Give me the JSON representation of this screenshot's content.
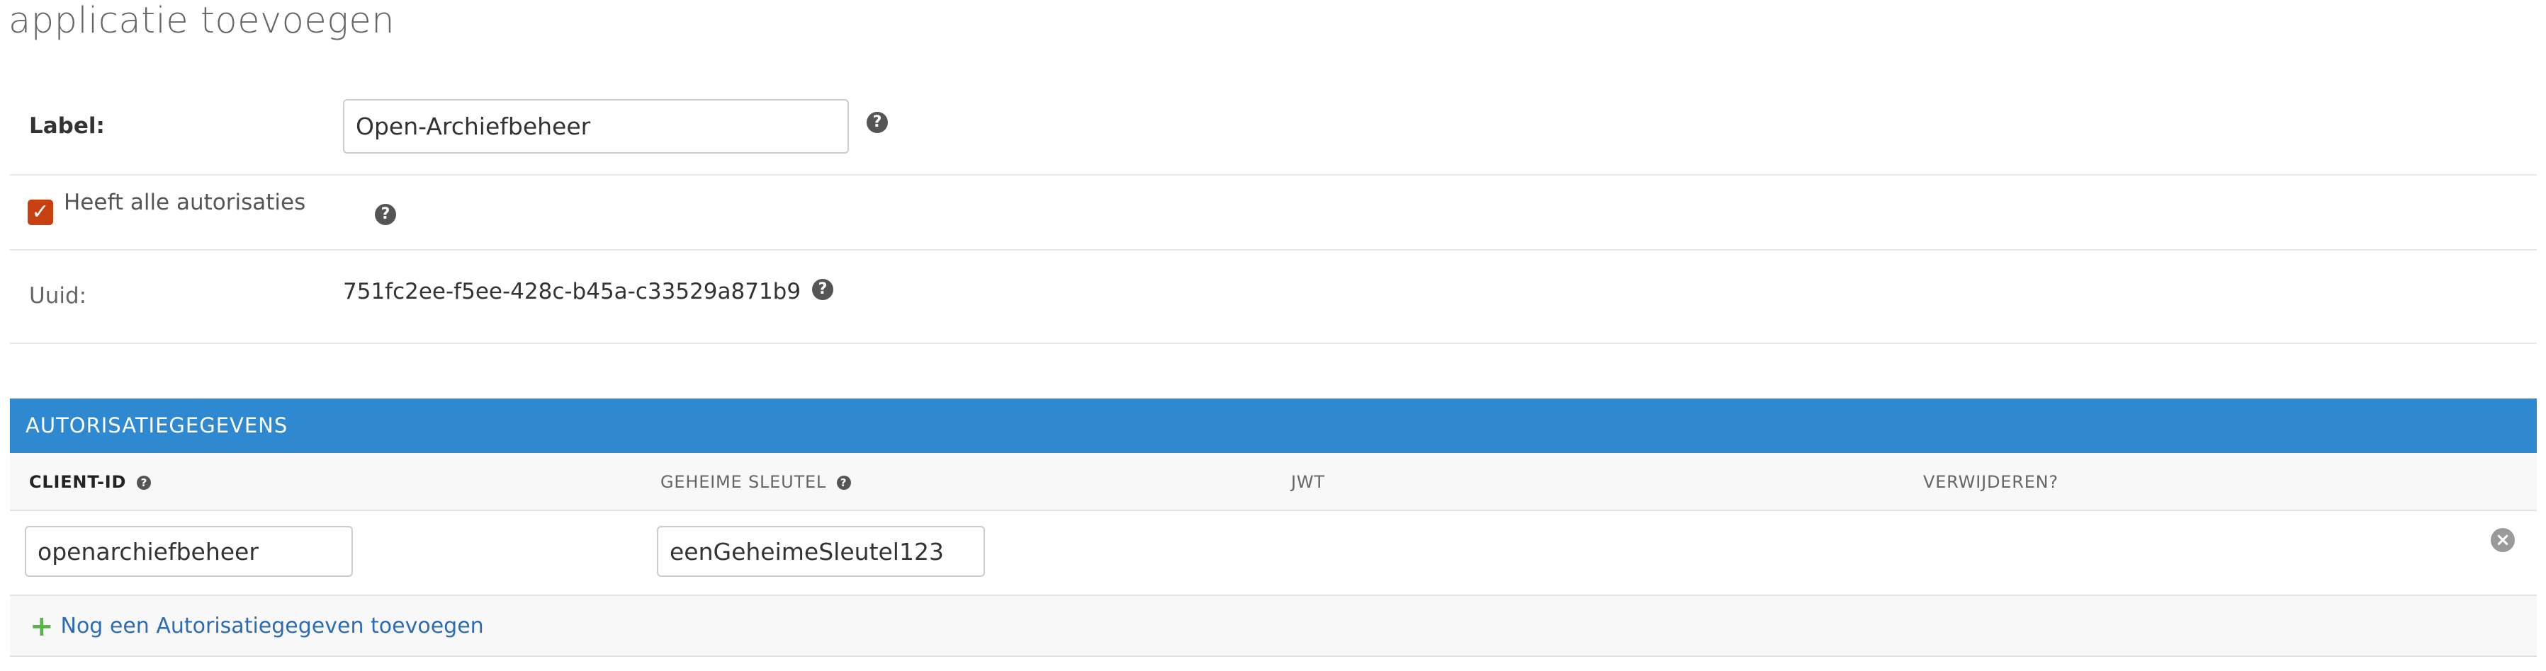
{
  "page": {
    "title": "applicatie toevoegen"
  },
  "form": {
    "label_field": {
      "label": "Label:",
      "value": "Open-Archiefbeheer",
      "help_icon": "question-circle-icon"
    },
    "all_authorizations": {
      "label": "Heeft alle autorisaties",
      "checked": true,
      "help_icon": "question-circle-icon"
    },
    "uuid": {
      "label": "Uuid:",
      "value": "751fc2ee-f5ee-428c-b45a-c33529a871b9",
      "help_icon": "question-circle-icon"
    }
  },
  "credentials": {
    "header": "AUTORISATIEGEGEVENS",
    "columns": {
      "client_id": "CLIENT-ID",
      "secret": "GEHEIME SLEUTEL",
      "jwt": "JWT",
      "delete": "VERWIJDEREN?"
    },
    "rows": [
      {
        "client_id": "openarchiefbeheer",
        "secret": "eenGeheimeSleutel123",
        "jwt": "",
        "delete_icon": "remove-circle-icon"
      }
    ],
    "add_link": "Nog een Autorisatiegegeven toevoegen",
    "add_icon": "plus-icon"
  },
  "colors": {
    "header_bg": "#2f89d0",
    "checkbox": "#c8400f",
    "link": "#2b6cb5",
    "plus": "#5ab34a"
  }
}
